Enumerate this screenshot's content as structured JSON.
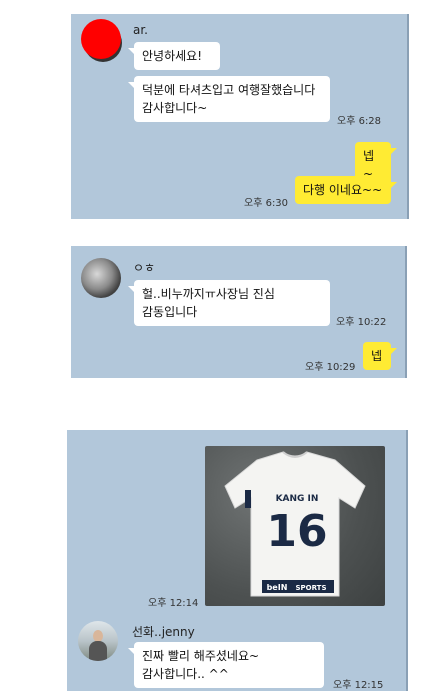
{
  "panels": [
    {
      "sender": "ar.",
      "messages": [
        {
          "text": "안녕하세요!"
        },
        {
          "text": "덕분에 타셔츠입고 여행잘했습니다 감사합니다~",
          "time": "오후 6:28"
        },
        {
          "text": "넵~",
          "mine": true
        },
        {
          "text": "다행 이네요~~",
          "mine": true,
          "time": "오후 6:30"
        }
      ]
    },
    {
      "sender": "ㅇㅎ",
      "messages": [
        {
          "text": "헐..비누까지ㅠ사장님 진심 감동입니다",
          "time": "오후 10:22"
        },
        {
          "text": "넵",
          "mine": true,
          "time": "오후 10:29"
        }
      ]
    },
    {
      "photo": {
        "time": "오후 12:14",
        "shirt_name": "KANG IN",
        "shirt_number": "16",
        "sponsor_a": "beIN",
        "sponsor_b": "SPORTS"
      },
      "sender": "선화..jenny",
      "messages": [
        {
          "text": "진짜 빨리 해주셨네요~ 감사합니다.. ^^",
          "time": "오후 12:15"
        }
      ]
    }
  ],
  "colors": {
    "chat_bg": "#b2c7da",
    "mine_bubble": "#ffeb33",
    "their_bubble": "#ffffff"
  }
}
